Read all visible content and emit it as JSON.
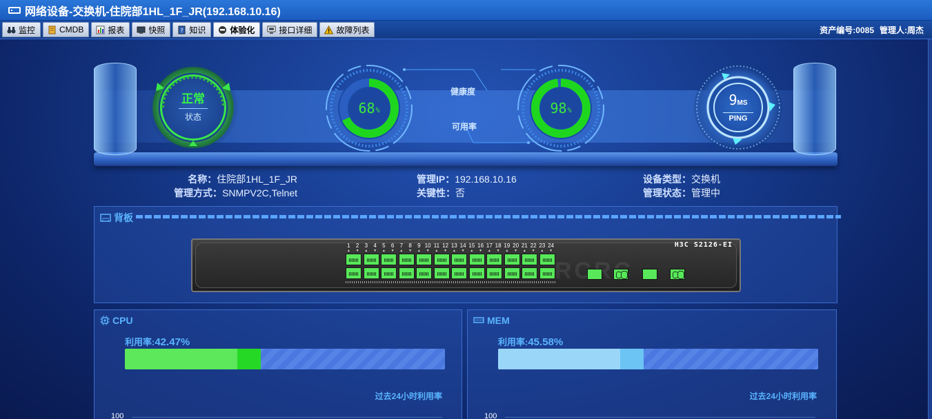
{
  "window": {
    "title": "网络设备-交换机-住院部1HL_1F_JR(192.168.10.16)"
  },
  "tabs": [
    {
      "label": "监控",
      "icon": "binoculars-icon"
    },
    {
      "label": "CMDB",
      "icon": "database-icon"
    },
    {
      "label": "报表",
      "icon": "chart-icon"
    },
    {
      "label": "快照",
      "icon": "monitor-icon"
    },
    {
      "label": "知识",
      "icon": "book-icon"
    },
    {
      "label": "体验化",
      "icon": "user-icon",
      "active": true
    },
    {
      "label": "接口详细",
      "icon": "screen-icon"
    },
    {
      "label": "故障列表",
      "icon": "warning-icon"
    }
  ],
  "meta": {
    "asset_no": "资产编号:0085",
    "manager": "管理人:周杰"
  },
  "dashboard": {
    "status": {
      "value": "正常",
      "label": "状态"
    },
    "health": {
      "value": "68",
      "unit": "%",
      "label": "健康度",
      "percent": 68
    },
    "availability": {
      "value": "98",
      "unit": "%",
      "label": "可用率",
      "percent": 98
    },
    "ping": {
      "value": "9",
      "unit": "MS",
      "label": "PING"
    }
  },
  "info": {
    "name_k": "名称：",
    "name_v": "住院部1HL_1F_JR",
    "mgmt_k": "管理方式：",
    "mgmt_v": "SNMPV2C,Telnet",
    "ip_k": "管理IP：",
    "ip_v": "192.168.10.16",
    "crit_k": "关键性：",
    "crit_v": "否",
    "type_k": "设备类型：",
    "type_v": "交换机",
    "state_k": "管理状态：",
    "state_v": "管理中"
  },
  "backplane": {
    "title": "背板",
    "model": "H3C S2126-EI",
    "brand": "RCRC",
    "port_numbers": [
      "1",
      "2",
      "3",
      "4",
      "5",
      "6",
      "7",
      "8",
      "9",
      "10",
      "11",
      "12",
      "13",
      "14",
      "15",
      "16",
      "17",
      "18",
      "19",
      "20",
      "21",
      "22",
      "23",
      "24"
    ]
  },
  "cpu": {
    "title": "CPU",
    "rate_label": "利用率:",
    "rate_value": "42.47%",
    "rate": 42.47,
    "history_label": "过去24小时利用率",
    "y_max": "100"
  },
  "mem": {
    "title": "MEM",
    "rate_label": "利用率:",
    "rate_value": "45.58%",
    "rate": 45.58,
    "history_label": "过去24小时利用率",
    "y_max": "100"
  },
  "colors": {
    "ok_green": "#37f04a",
    "accent_blue": "#5ab4ff",
    "cpu_bar": "#5ce85a",
    "mem_bar": "#9ad6f8"
  }
}
